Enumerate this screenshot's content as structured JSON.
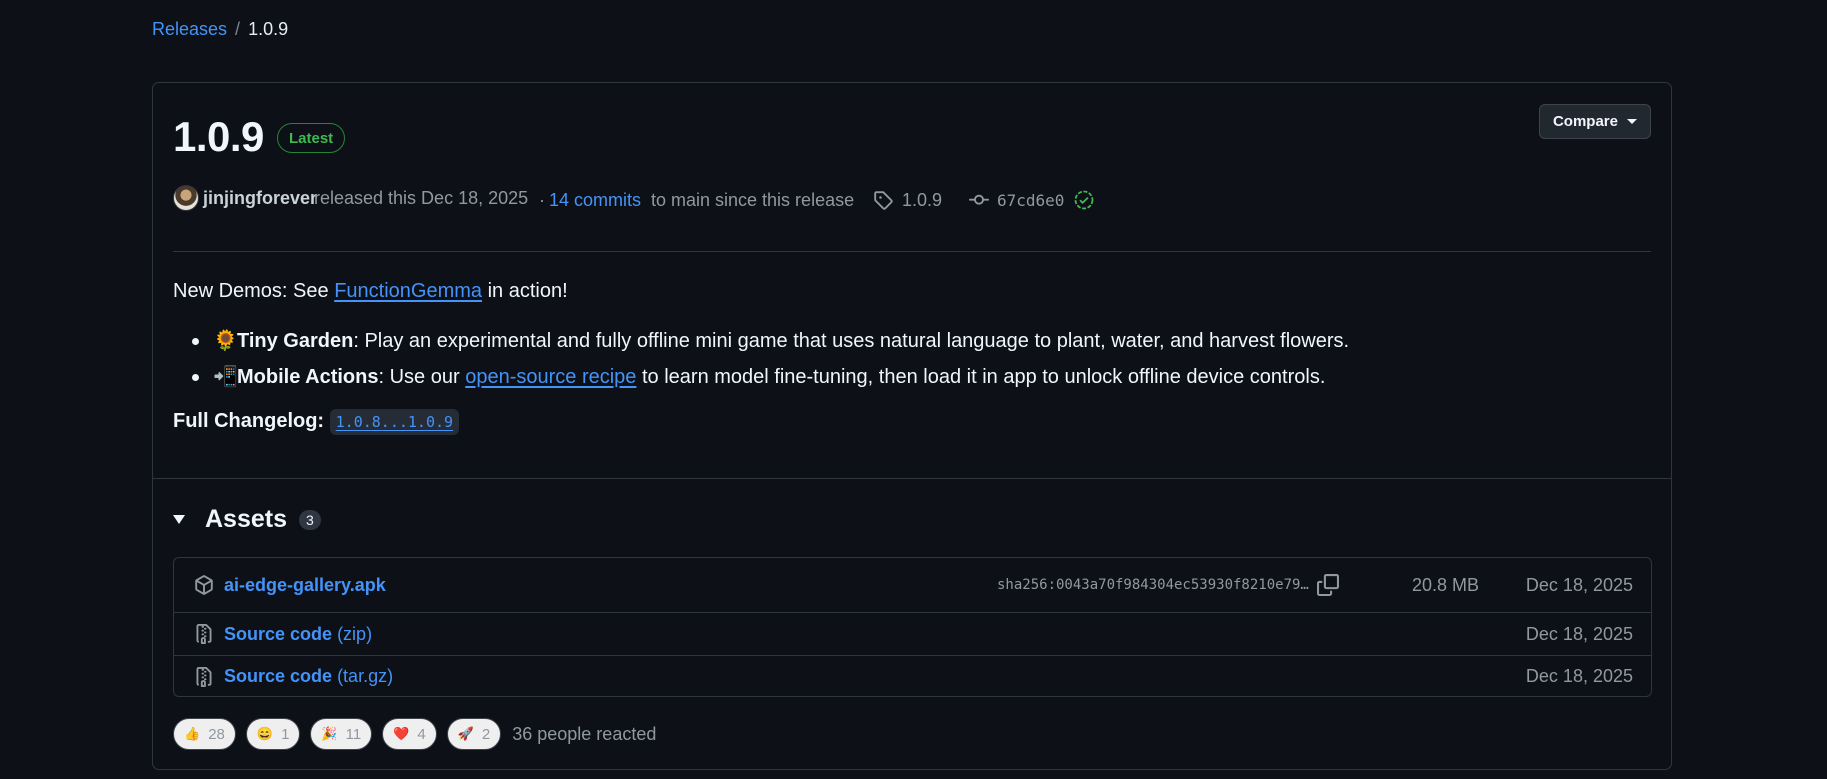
{
  "breadcrumb": {
    "parent": "Releases",
    "separator": "/",
    "current": "1.0.9"
  },
  "release": {
    "title": "1.0.9",
    "badge": "Latest",
    "compare_label": "Compare",
    "author": "jinjingforever",
    "released_text": "released this Dec 18, 2025",
    "commits_prefix": "·",
    "commits_link": "14 commits",
    "commits_suffix": "to main since this release",
    "tag": "1.0.9",
    "commit_hash": "67cd6e0"
  },
  "notes": {
    "intro_prefix": "New Demos: See",
    "intro_link": "FunctionGemma",
    "intro_suffix": "in action!",
    "items": [
      {
        "emoji": "🌻",
        "title": "Tiny Garden",
        "text_before": ": Play an experimental and fully offline mini game that uses natural language to plant, water, and harvest flowers.",
        "link": "",
        "text_after": ""
      },
      {
        "emoji": "📲",
        "title": "Mobile Actions",
        "text_before": ": Use our",
        "link": "open-source recipe",
        "text_after": "to learn model fine-tuning, then load it in app to unlock offline device controls."
      }
    ],
    "changelog_label": "Full Changelog:",
    "changelog_link": "1.0.8...1.0.9"
  },
  "assets": {
    "title": "Assets",
    "count": "3",
    "rows": [
      {
        "name": "ai-edge-gallery.apk",
        "suffix": "",
        "sha": "sha256:0043a70f984304ec53930f8210e79…",
        "size": "20.8 MB",
        "date": "Dec 18, 2025",
        "icon": "package-icon"
      },
      {
        "name": "Source code",
        "suffix": "(zip)",
        "sha": "",
        "size": "",
        "date": "Dec 18, 2025",
        "icon": "file-zip-icon"
      },
      {
        "name": "Source code",
        "suffix": "(tar.gz)",
        "sha": "",
        "size": "",
        "date": "Dec 18, 2025",
        "icon": "file-zip-icon"
      }
    ]
  },
  "reactions": {
    "items": [
      {
        "emoji": "👍",
        "count": "28"
      },
      {
        "emoji": "😄",
        "count": "1"
      },
      {
        "emoji": "🎉",
        "count": "11"
      },
      {
        "emoji": "❤️",
        "count": "4"
      },
      {
        "emoji": "🚀",
        "count": "2"
      }
    ],
    "summary": "36 people reacted"
  },
  "colors": {
    "background": "#0d1117",
    "link": "#4493f8",
    "latest_green": "#3fb950",
    "muted": "#9198a1",
    "border": "#30363d"
  }
}
